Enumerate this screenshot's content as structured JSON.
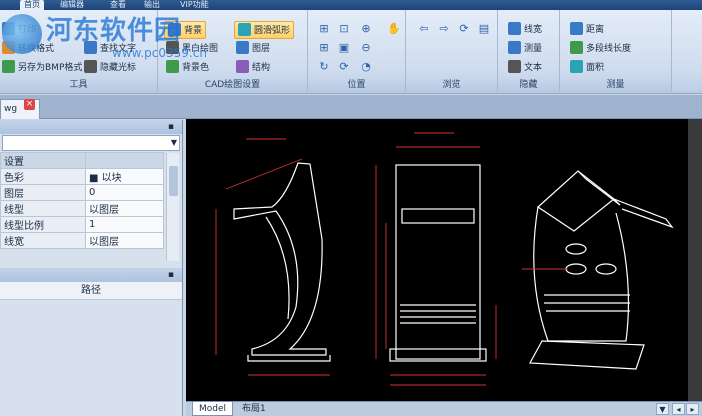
{
  "ribbon_tabs": [
    "首页",
    "编辑器",
    "查看",
    "输出",
    "VIP功能"
  ],
  "watermark": {
    "site_name": "河东软件园",
    "url": "www.pc0359.cn"
  },
  "tools_group": {
    "items": [
      "打印",
      "转换格式",
      "另存为BMP格式",
      "查找文字",
      "隐藏光标"
    ],
    "label": "工具"
  },
  "cad_settings_group": {
    "items": [
      "背景",
      "圆滑弧形",
      "黑白绘图",
      "图层",
      "背景色",
      "结构"
    ],
    "label": "CAD绘图设置"
  },
  "position_group": {
    "label": "位置"
  },
  "browse_group": {
    "label": "浏览"
  },
  "hide_group": {
    "items": [
      "线宽",
      "测量",
      "文本"
    ],
    "label": "隐藏"
  },
  "measure_group": {
    "items": [
      "距离",
      "多段线长度",
      "面积"
    ],
    "label": "测量"
  },
  "document_tab": {
    "name": "wg"
  },
  "properties": {
    "rows": [
      {
        "key": "设置",
        "value": ""
      },
      {
        "key": "色彩",
        "value": "以块"
      },
      {
        "key": "图层",
        "value": "0"
      },
      {
        "key": "线型",
        "value": "以图层"
      },
      {
        "key": "线型比例",
        "value": "1"
      },
      {
        "key": "线宽",
        "value": "以图层"
      }
    ]
  },
  "path_panel": {
    "header": "路径"
  },
  "layout_tabs": [
    "Model",
    "布局1"
  ],
  "colors": {
    "ribbon": "#dfe9f6",
    "canvas": "#000000",
    "highlight": "#ffd06a",
    "dimension": "#d43030",
    "outline": "#ffffff"
  }
}
